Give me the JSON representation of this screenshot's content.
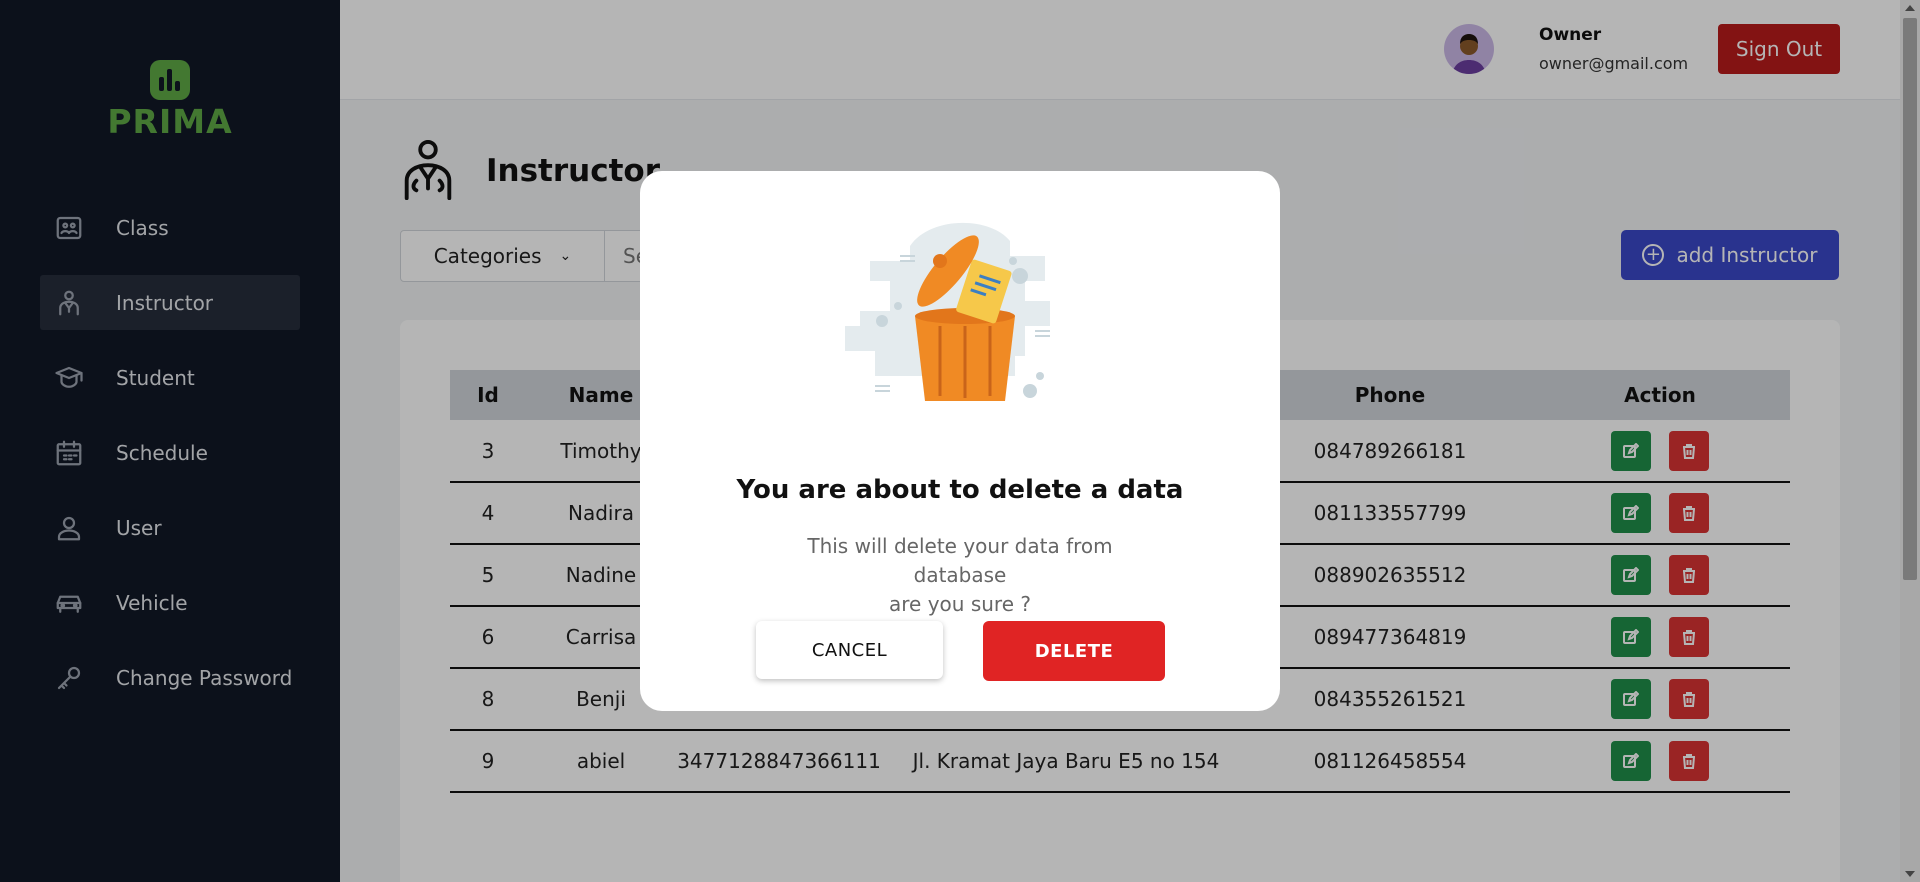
{
  "brand": {
    "name": "PRIMA",
    "color": "#5faa45"
  },
  "sidebar": {
    "items": [
      {
        "label": "Class",
        "icon": "class-icon"
      },
      {
        "label": "Instructor",
        "icon": "instructor-icon",
        "active": true
      },
      {
        "label": "Student",
        "icon": "student-icon"
      },
      {
        "label": "Schedule",
        "icon": "schedule-icon"
      },
      {
        "label": "User",
        "icon": "user-icon"
      },
      {
        "label": "Vehicle",
        "icon": "vehicle-icon"
      },
      {
        "label": "Change Password",
        "icon": "key-icon"
      }
    ]
  },
  "header": {
    "user_name": "Owner",
    "user_email": "owner@gmail.com",
    "signout_label": "Sign Out"
  },
  "page": {
    "title": "Instructor",
    "categories_label": "Categories",
    "search_placeholder": "Se",
    "add_label": "add Instructor"
  },
  "table": {
    "columns": [
      "Id",
      "Name",
      "",
      "",
      "Phone",
      "Action"
    ],
    "rows": [
      {
        "id": "3",
        "name": "Timothy",
        "nik": "",
        "address": "",
        "phone": "084789266181"
      },
      {
        "id": "4",
        "name": "Nadira",
        "nik": "",
        "address": "",
        "phone": "081133557799"
      },
      {
        "id": "5",
        "name": "Nadine",
        "nik": "",
        "address": "",
        "phone": "088902635512"
      },
      {
        "id": "6",
        "name": "Carrisa",
        "nik": "",
        "address": "",
        "phone": "089477364819"
      },
      {
        "id": "8",
        "name": "Benji",
        "nik": "",
        "address": "",
        "phone": "084355261521"
      },
      {
        "id": "9",
        "name": "abiel",
        "nik": "3477128847366111",
        "address": "Jl. Kramat Jaya Baru E5 no 154",
        "phone": "081126458554"
      }
    ]
  },
  "modal": {
    "title": "You are about to delete a data",
    "line1": "This will delete your data from database",
    "line2": "are you sure ?",
    "cancel_label": "CANCEL",
    "delete_label": "DELETE"
  },
  "colors": {
    "sidebar_bg": "#111827",
    "signout": "#b91c1c",
    "add_button": "#3b48c9",
    "delete_button": "#e02424",
    "edit_action": "#1f8f4a",
    "delete_action": "#d93434"
  }
}
